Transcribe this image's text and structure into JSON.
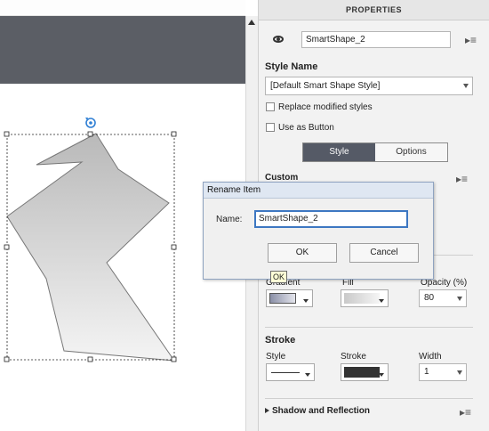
{
  "panel": {
    "header": "PROPERTIES",
    "item_name": "SmartShape_2",
    "style_name_label": "Style Name",
    "style_name_value": "[Default Smart Shape Style]",
    "replace_modified_label": "Replace modified styles",
    "use_as_button_label": "Use as Button",
    "tabs": {
      "style": "Style",
      "options": "Options"
    },
    "custom_label": "Custom",
    "fill_section": {
      "gradient_label": "Gradient",
      "fill_label": "Fill",
      "opacity_label": "Opacity (%)",
      "opacity_value": "80"
    },
    "stroke_section": {
      "title": "Stroke",
      "style_label": "Style",
      "stroke_label": "Stroke",
      "width_label": "Width",
      "width_value": "1"
    },
    "shadow_reflection_label": "Shadow and Reflection"
  },
  "dialog": {
    "title": "Rename Item",
    "name_label": "Name:",
    "name_value": "SmartShape_2",
    "ok_label": "OK",
    "cancel_label": "Cancel",
    "tooltip": "OK"
  },
  "colors": {
    "dark_band": "#5b5e65",
    "selected_tab": "#555a66",
    "stroke_color": "#333333",
    "dialog_focus": "#3d77c2"
  },
  "icons": [
    "eye-icon",
    "panel-menu-icon",
    "rotate-handle-icon",
    "dropdown-caret-icon",
    "expand-arrow-icon",
    "scroll-up-arrow-icon"
  ]
}
